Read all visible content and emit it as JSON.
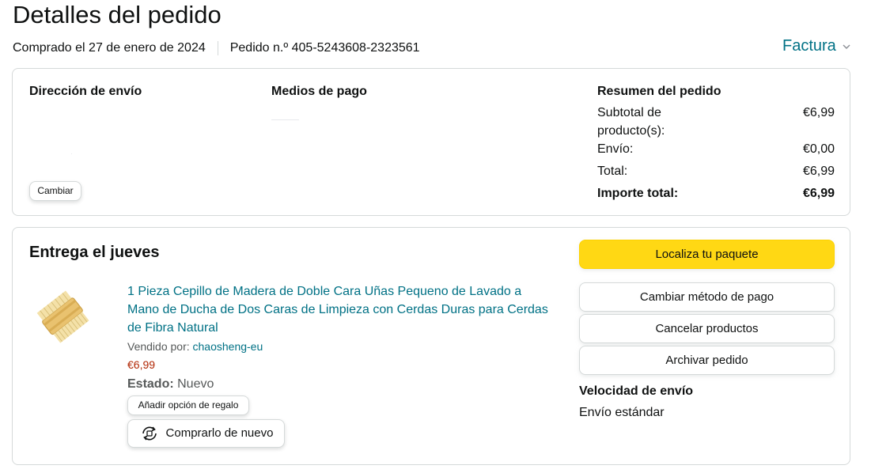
{
  "page": {
    "title": "Detalles del pedido",
    "ordered_date": "Comprado el 27 de enero de 2024",
    "order_number": "Pedido n.º 405-5243608-2323561",
    "invoice_label": "Factura"
  },
  "summary_box": {
    "shipping_address_heading": "Dirección de envío",
    "change_button": "Cambiar",
    "payment_heading": "Medios de pago",
    "order_summary_heading": "Resumen del pedido",
    "rows": [
      {
        "label": "Subtotal de producto(s):",
        "value": "€6,99"
      },
      {
        "label": "Envío:",
        "value": "€0,00"
      },
      {
        "label": "Total:",
        "value": "€6,99"
      },
      {
        "label": "Importe total:",
        "value": "€6,99"
      }
    ]
  },
  "delivery": {
    "heading": "Entrega el jueves",
    "item": {
      "title": "1 Pieza Cepillo de Madera de Doble Cara Uñas Pequeno de Lavado a Mano de Ducha de Dos Caras de Limpieza con Cerdas Duras para Cerdas de Fibra Natural",
      "sold_by_label": "Vendido por:",
      "seller": "chaosheng-eu",
      "price": "€6,99",
      "condition_label": "Estado:",
      "condition_value": "Nuevo",
      "gift_button": "Añadir opción de regalo",
      "buy_again_button": "Comprarlo de nuevo"
    },
    "actions": {
      "track": "Localiza tu paquete",
      "change_payment": "Cambiar método de pago",
      "cancel": "Cancelar productos",
      "archive": "Archivar pedido"
    },
    "shipping_speed_heading": "Velocidad de envío",
    "shipping_speed_value": "Envío estándar"
  },
  "colors": {
    "link": "#007185",
    "price": "#b12704",
    "primary_button": "#ffd814",
    "border": "#d5d9d9"
  }
}
